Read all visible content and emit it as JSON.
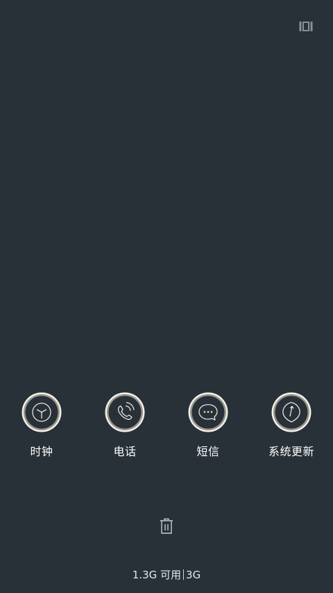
{
  "top_bar": {
    "icon": "multi-window-icon"
  },
  "recent_apps": [
    {
      "label": "时钟",
      "icon": "clock-icon"
    },
    {
      "label": "电话",
      "icon": "phone-icon"
    },
    {
      "label": "短信",
      "icon": "message-icon"
    },
    {
      "label": "系统更新",
      "icon": "system-update-icon"
    }
  ],
  "bottom": {
    "clear_icon": "trash-icon",
    "memory_available": "1.3G 可用",
    "memory_total": "3G"
  },
  "colors": {
    "background": "#283138",
    "ring_outer": "#f2f0ec",
    "ring_inner": "#9a9589",
    "icon_stroke": "#e8e6e0"
  }
}
